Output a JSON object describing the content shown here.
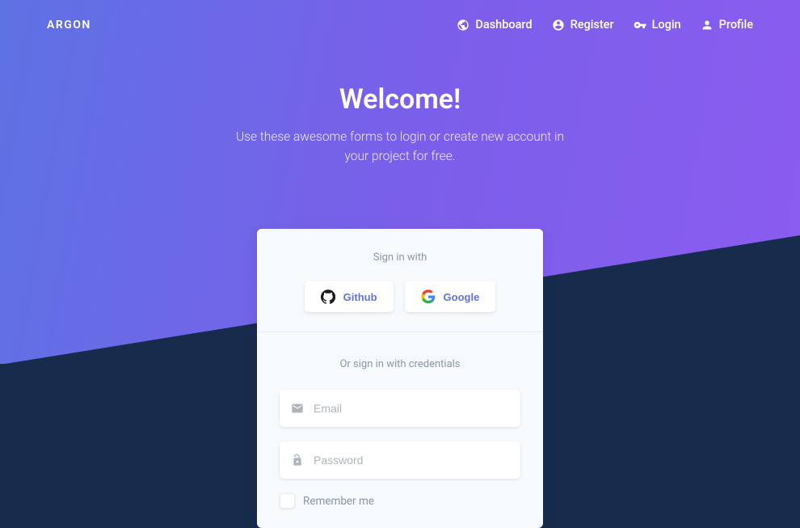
{
  "brand": "ARGON",
  "nav": {
    "dashboard": "Dashboard",
    "register": "Register",
    "login": "Login",
    "profile": "Profile"
  },
  "hero": {
    "title": "Welcome!",
    "subtitle_l1": "Use these awesome forms to login or create new account in",
    "subtitle_l2": "your project for free."
  },
  "card": {
    "signin_with": "Sign in with",
    "github": "Github",
    "google": "Google",
    "or": "Or sign in with credentials",
    "email_placeholder": "Email",
    "password_placeholder": "Password",
    "remember": "Remember me"
  }
}
